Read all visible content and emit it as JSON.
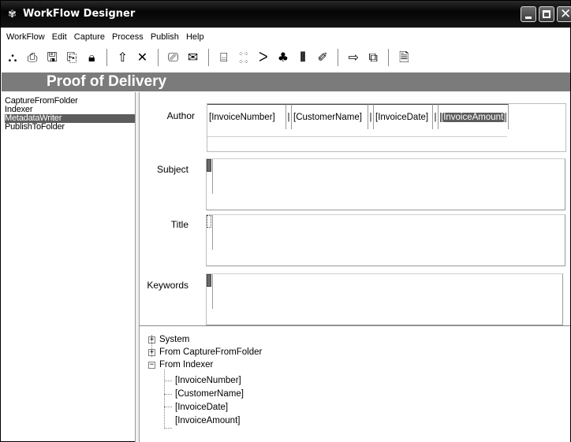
{
  "window": {
    "title": "WorkFlow Designer"
  },
  "menu": [
    "WorkFlow",
    "Edit",
    "Capture",
    "Process",
    "Publish",
    "Help"
  ],
  "toolbar": {
    "group1": [
      "new-workflow-icon",
      "print-icon",
      "save-icon",
      "save-as-icon",
      "lock-icon"
    ],
    "group2": [
      "up-arrow-icon",
      "delete-icon"
    ],
    "group3": [
      "capture-folder-icon",
      "email-icon"
    ],
    "group4": [
      "scan-icon",
      "ocr-icon",
      "signature-icon",
      "meta-icon",
      "barcode-icon",
      "script-icon"
    ],
    "group5": [
      "publish-icon",
      "copy-icon"
    ],
    "group6": [
      "preview-icon"
    ]
  },
  "header": {
    "title": "Proof of Delivery"
  },
  "steps": [
    {
      "label": "CaptureFromFolder",
      "selected": false
    },
    {
      "label": "Indexer",
      "selected": false
    },
    {
      "label": "MetadataWriter",
      "selected": true
    },
    {
      "label": "PublishToFolder",
      "selected": false
    }
  ],
  "fields": {
    "author": {
      "label": "Author",
      "tokens": [
        "[InvoiceNumber]",
        "|",
        "[CustomerName]",
        "|",
        "[InvoiceDate]",
        "|",
        "[InvoiceAmount]"
      ],
      "selected_token": "[InvoiceAmount]"
    },
    "subject": {
      "label": "Subject"
    },
    "title": {
      "label": "Title"
    },
    "keywords": {
      "label": "Keywords"
    }
  },
  "tree": {
    "nodes": [
      {
        "label": "System",
        "expander": "+"
      },
      {
        "label": "From CaptureFromFolder",
        "expander": "+"
      },
      {
        "label": "From Indexer",
        "expander": "−"
      }
    ],
    "children": [
      "[InvoiceNumber]",
      "[CustomerName]",
      "[InvoiceDate]",
      "[InvoiceAmount]"
    ]
  }
}
